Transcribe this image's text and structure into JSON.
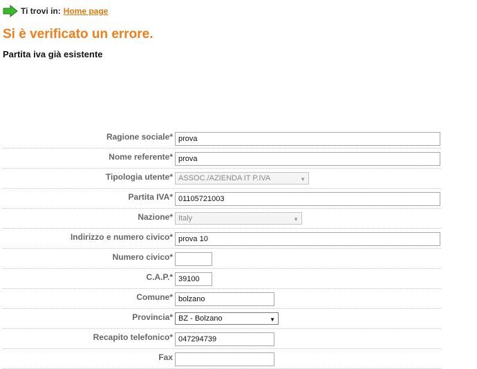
{
  "breadcrumb": {
    "prefix": "Ti trovi in:",
    "link": "Home page"
  },
  "error": {
    "title": "Si è verificato un errore.",
    "message": "Partita iva già esistente"
  },
  "form": {
    "ragione_sociale": {
      "label": "Ragione sociale*",
      "value": "prova"
    },
    "nome_referente": {
      "label": "Nome referente*",
      "value": "prova"
    },
    "tipologia_utente": {
      "label": "Tipologia utente*",
      "value": "ASSOC./AZIENDA IT P.IVA"
    },
    "partita_iva": {
      "label": "Partita IVA*",
      "value": "01105721003"
    },
    "nazione": {
      "label": "Nazione*",
      "value": "Italy"
    },
    "indirizzo": {
      "label": "Indirizzo e numero civico*",
      "value": "prova 10"
    },
    "numero_civico": {
      "label": "Numero civico*",
      "value": ""
    },
    "cap": {
      "label": "C.A.P.*",
      "value": "39100"
    },
    "comune": {
      "label": "Comune*",
      "value": "bolzano"
    },
    "provincia": {
      "label": "Provincia*",
      "value": "BZ - Bolzano"
    },
    "recapito": {
      "label": "Recapito telefonico*",
      "value": "047294739"
    },
    "fax": {
      "label": "Fax",
      "value": ""
    }
  },
  "colors": {
    "accent": "#f07e1b",
    "link": "#e07a10",
    "arrow": "#3cb82c"
  }
}
